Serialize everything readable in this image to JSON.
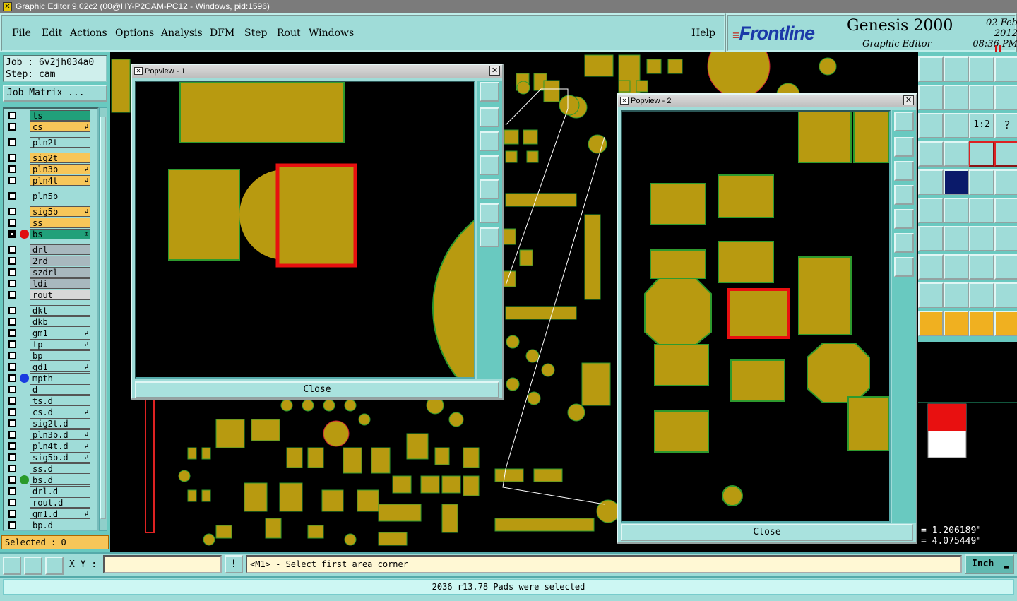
{
  "window": {
    "title": "Graphic Editor 9.02c2 (00@HY-P2CAM-PC12 - Windows, pid:1596)"
  },
  "menu": [
    {
      "label": "File"
    },
    {
      "label": "Edit"
    },
    {
      "label": "Actions"
    },
    {
      "label": "Options"
    },
    {
      "label": "Analysis"
    },
    {
      "label": "DFM"
    },
    {
      "label": "Step"
    },
    {
      "label": "Rout"
    },
    {
      "label": "Windows"
    }
  ],
  "help_label": "Help",
  "brand": {
    "logo": "Frontline",
    "product": "Genesis 2000",
    "subtitle": "Graphic Editor",
    "date": "02 Feb 2012",
    "time": "08:36 PM"
  },
  "job": {
    "job_line": "Job : 6v2jh034a0",
    "step_line": "Step: cam",
    "matrix_button": "Job Matrix ..."
  },
  "layers": [
    {
      "name": "ts",
      "color": "#21a07a",
      "selected": false,
      "dot": "",
      "flag": ""
    },
    {
      "name": "cs",
      "color": "#f7c659",
      "selected": false,
      "dot": "",
      "flag": "↲"
    },
    {
      "name": "pln2t",
      "color": "#9fdcd8",
      "selected": false,
      "dot": "",
      "flag": ""
    },
    {
      "name": "sig2t",
      "color": "#f7c659",
      "selected": false,
      "dot": "",
      "flag": ""
    },
    {
      "name": "pln3b",
      "color": "#f7c659",
      "selected": false,
      "dot": "",
      "flag": "↲"
    },
    {
      "name": "pln4t",
      "color": "#f7c659",
      "selected": false,
      "dot": "",
      "flag": "↲"
    },
    {
      "name": "pln5b",
      "color": "#9fdcd8",
      "selected": false,
      "dot": "",
      "flag": ""
    },
    {
      "name": "sig5b",
      "color": "#f7c659",
      "selected": false,
      "dot": "",
      "flag": "↲"
    },
    {
      "name": "ss",
      "color": "#f7c659",
      "selected": false,
      "dot": "",
      "flag": ""
    },
    {
      "name": "bs",
      "color": "#21a07a",
      "selected": true,
      "dot": "#e01010",
      "flag": "⊞"
    },
    {
      "name": "drl",
      "color": "#a8b8be",
      "selected": false,
      "dot": "",
      "flag": ""
    },
    {
      "name": "2rd",
      "color": "#a8b8be",
      "selected": false,
      "dot": "",
      "flag": ""
    },
    {
      "name": "szdrl",
      "color": "#a8b8be",
      "selected": false,
      "dot": "",
      "flag": ""
    },
    {
      "name": "ldi",
      "color": "#a8b8be",
      "selected": false,
      "dot": "",
      "flag": ""
    },
    {
      "name": "rout",
      "color": "#d8d8d8",
      "selected": false,
      "dot": "",
      "flag": ""
    },
    {
      "name": "dkt",
      "color": "#9fdcd8",
      "selected": false,
      "dot": "",
      "flag": ""
    },
    {
      "name": "dkb",
      "color": "#9fdcd8",
      "selected": false,
      "dot": "",
      "flag": ""
    },
    {
      "name": "gm1",
      "color": "#9fdcd8",
      "selected": false,
      "dot": "",
      "flag": "↲"
    },
    {
      "name": "tp",
      "color": "#9fdcd8",
      "selected": false,
      "dot": "",
      "flag": "↲"
    },
    {
      "name": "bp",
      "color": "#9fdcd8",
      "selected": false,
      "dot": "",
      "flag": ""
    },
    {
      "name": "gd1",
      "color": "#9fdcd8",
      "selected": false,
      "dot": "",
      "flag": "↲"
    },
    {
      "name": "mpth",
      "color": "#9fdcd8",
      "selected": false,
      "dot": "#1a3ce0",
      "flag": ""
    },
    {
      "name": "d",
      "color": "#9fdcd8",
      "selected": false,
      "dot": "",
      "flag": ""
    },
    {
      "name": "ts.d",
      "color": "#9fdcd8",
      "selected": false,
      "dot": "",
      "flag": ""
    },
    {
      "name": "cs.d",
      "color": "#9fdcd8",
      "selected": false,
      "dot": "",
      "flag": "↲"
    },
    {
      "name": "sig2t.d",
      "color": "#9fdcd8",
      "selected": false,
      "dot": "",
      "flag": ""
    },
    {
      "name": "pln3b.d",
      "color": "#9fdcd8",
      "selected": false,
      "dot": "",
      "flag": "↲"
    },
    {
      "name": "pln4t.d",
      "color": "#9fdcd8",
      "selected": false,
      "dot": "",
      "flag": "↲"
    },
    {
      "name": "sig5b.d",
      "color": "#9fdcd8",
      "selected": false,
      "dot": "",
      "flag": "↲"
    },
    {
      "name": "ss.d",
      "color": "#9fdcd8",
      "selected": false,
      "dot": "",
      "flag": ""
    },
    {
      "name": "bs.d",
      "color": "#9fdcd8",
      "selected": false,
      "dot": "#2a9a2a",
      "flag": ""
    },
    {
      "name": "drl.d",
      "color": "#9fdcd8",
      "selected": false,
      "dot": "",
      "flag": ""
    },
    {
      "name": "rout.d",
      "color": "#9fdcd8",
      "selected": false,
      "dot": "",
      "flag": ""
    },
    {
      "name": "gm1.d",
      "color": "#9fdcd8",
      "selected": false,
      "dot": "",
      "flag": "↲"
    },
    {
      "name": "bp.d",
      "color": "#9fdcd8",
      "selected": false,
      "dot": "",
      "flag": ""
    }
  ],
  "selected_count": "Selected : 0",
  "popview1": {
    "title": "Popview - 1",
    "close": "Close"
  },
  "popview2": {
    "title": "Popview - 2",
    "close": "Close"
  },
  "coords": {
    "x": "= 1.206189\"",
    "y": "= 4.075449\""
  },
  "status": {
    "xy_label": "X Y :",
    "xy_value": "",
    "prompt": "<M1> - Select first area corner",
    "units": "Inch",
    "message": "2036 r13.78 Pads were selected"
  },
  "colors": {
    "copper": "#b89a10",
    "copper_edge": "#2e9a2e",
    "highlight": "#e81010",
    "panel": "#9fdcd8"
  }
}
